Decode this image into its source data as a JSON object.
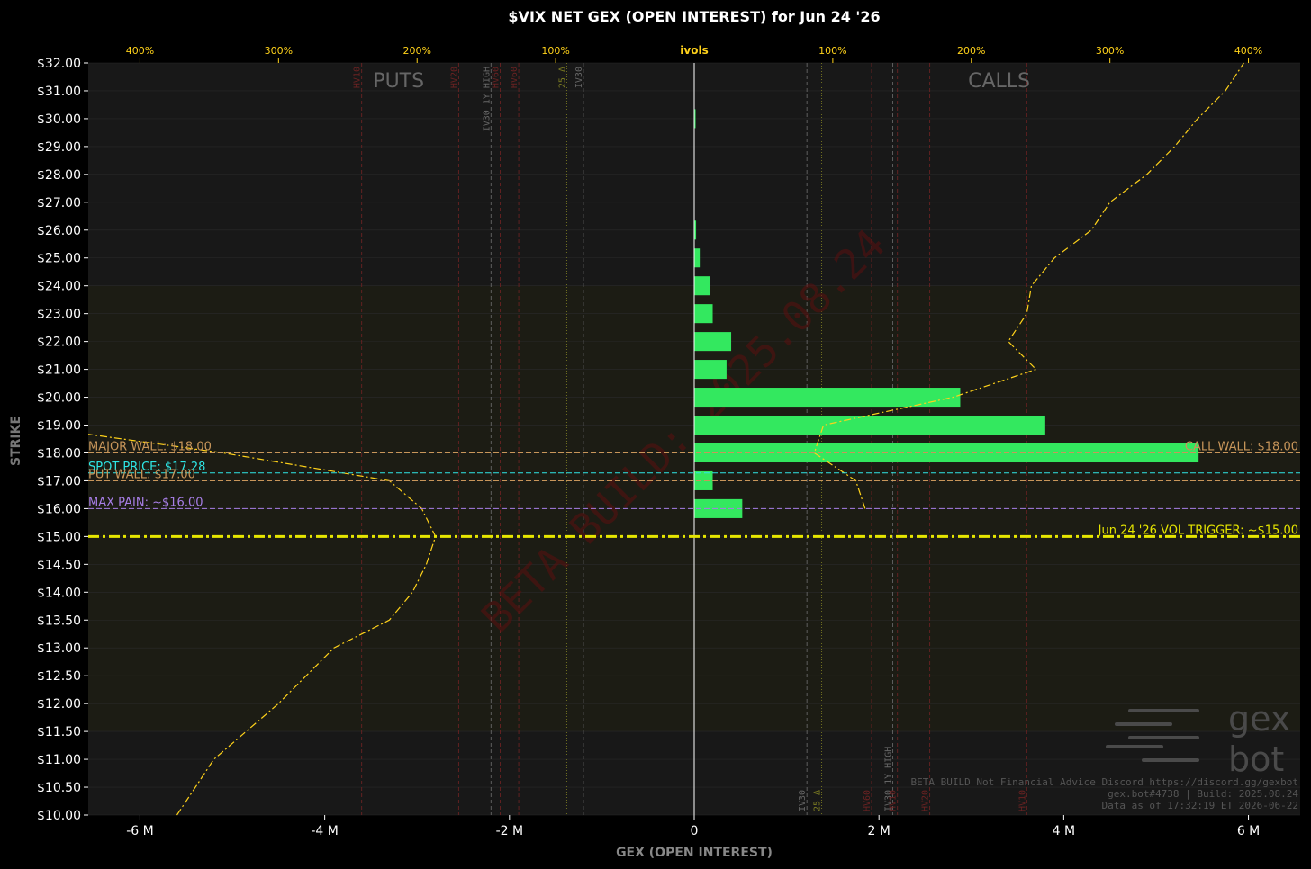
{
  "chart_data": {
    "type": "bar",
    "orientation": "horizontal",
    "title": "$VIX NET GEX (OPEN INTEREST) for Jun 24 '26",
    "xlabel": "GEX (OPEN INTEREST)",
    "ylabel": "STRIKE",
    "top_axis_label": "ivols",
    "xlim": [
      -6.56,
      6.56
    ],
    "x_ticks": [
      {
        "v": -6,
        "label": "-6 M"
      },
      {
        "v": -4,
        "label": "-4 M"
      },
      {
        "v": -2,
        "label": "-2 M"
      },
      {
        "v": 0,
        "label": "0"
      },
      {
        "v": 2,
        "label": "2 M"
      },
      {
        "v": 4,
        "label": "4 M"
      },
      {
        "v": 6,
        "label": "6 M"
      }
    ],
    "top_ticks": [
      {
        "v": -6.0,
        "label": "400%"
      },
      {
        "v": -4.5,
        "label": "300%"
      },
      {
        "v": -3.0,
        "label": "200%"
      },
      {
        "v": -1.5,
        "label": "100%"
      },
      {
        "v": 1.5,
        "label": "100%"
      },
      {
        "v": 3.0,
        "label": "200%"
      },
      {
        "v": 4.5,
        "label": "300%"
      },
      {
        "v": 6.0,
        "label": "400%"
      }
    ],
    "strike_labels": [
      "$10.00",
      "$10.50",
      "$11.00",
      "$11.50",
      "$12.00",
      "$12.50",
      "$13.00",
      "$13.50",
      "$14.00",
      "$14.50",
      "$15.00",
      "$16.00",
      "$17.00",
      "$18.00",
      "$19.00",
      "$20.00",
      "$21.00",
      "$22.00",
      "$23.00",
      "$24.00",
      "$25.00",
      "$26.00",
      "$27.00",
      "$28.00",
      "$29.00",
      "$30.00",
      "$31.00",
      "$32.00"
    ],
    "series": [
      {
        "color": "#33e85f",
        "categories": [
          "$30.00",
          "$26.00",
          "$25.00",
          "$24.00",
          "$23.00",
          "$22.00",
          "$21.00",
          "$20.00",
          "$19.00",
          "$18.00",
          "$17.00",
          "$16.00"
        ],
        "values": [
          0.01,
          0.02,
          0.06,
          0.17,
          0.2,
          0.4,
          0.35,
          2.88,
          3.8,
          5.46,
          0.2,
          0.52
        ]
      }
    ],
    "call_ivol_curve": {
      "color": "#ffd21a",
      "points": [
        [
          "$16.00",
          1.85
        ],
        [
          "$17.00",
          1.75
        ],
        [
          "$18.00",
          1.3
        ],
        [
          "$19.00",
          1.4
        ],
        [
          "$20.00",
          2.8
        ],
        [
          "$21.00",
          3.7
        ],
        [
          "$22.00",
          3.4
        ],
        [
          "$23.00",
          3.6
        ],
        [
          "$24.00",
          3.65
        ],
        [
          "$25.00",
          3.9
        ],
        [
          "$26.00",
          4.3
        ],
        [
          "$27.00",
          4.5
        ],
        [
          "$28.00",
          4.9
        ],
        [
          "$29.00",
          5.2
        ],
        [
          "$30.00",
          5.45
        ],
        [
          "$31.00",
          5.75
        ],
        [
          "$32.00",
          5.95
        ]
      ]
    },
    "put_ivol_curve": {
      "color": "#ffd21a",
      "points": [
        [
          "$10.00",
          -5.6
        ],
        [
          "$11.00",
          -5.2
        ],
        [
          "$12.00",
          -4.5
        ],
        [
          "$13.00",
          -3.9
        ],
        [
          "$13.50",
          -3.3
        ],
        [
          "$14.00",
          -3.05
        ],
        [
          "$14.50",
          -2.9
        ],
        [
          "$15.00",
          -2.8
        ],
        [
          "$16.00",
          -2.95
        ],
        [
          "$17.00",
          -3.3
        ],
        [
          "$18.00",
          -5.1
        ],
        [
          "$18.67",
          -6.56
        ]
      ]
    },
    "levels": [
      {
        "strike": "$18.00",
        "label": "MAJOR WALL: $18.00",
        "color": "#c8965a"
      },
      {
        "strike": "$17.28",
        "label": "SPOT PRICE: $17.28",
        "color": "#2ee6e6"
      },
      {
        "strike": "$17.00",
        "label": "PUT WALL: $17.00",
        "color": "#c8965a"
      },
      {
        "strike": "$16.00",
        "label": "MAX PAIN: ~$16.00",
        "color": "#a77ee6"
      },
      {
        "strike": "$15.00",
        "label": "Jun 24 '26 VOL TRIGGER: ~$15.00",
        "color": "#e6e600"
      },
      {
        "strike": "$18.00",
        "label": "CALL WALL: $18.00",
        "color": "#c8965a"
      }
    ],
    "vlines_put": [
      {
        "x": -3.6,
        "label": "HV10"
      },
      {
        "x": -2.55,
        "label": "HV20"
      },
      {
        "x": -2.2,
        "label": "IV30 1Y HIGH"
      },
      {
        "x": -2.1,
        "label": "HV60"
      },
      {
        "x": -1.9,
        "label": "HV60"
      },
      {
        "x": -1.2,
        "label": "IV30"
      },
      {
        "x": -1.38,
        "label": "25 Δ"
      }
    ],
    "vlines_call": [
      {
        "x": 1.22,
        "label": "IV30"
      },
      {
        "x": 1.38,
        "label": "25 Δ"
      },
      {
        "x": 1.92,
        "label": "HV60"
      },
      {
        "x": 2.15,
        "label": "IV30 1Y HIGH"
      },
      {
        "x": 2.2,
        "label": "HV10"
      },
      {
        "x": 2.55,
        "label": "HV20"
      },
      {
        "x": 3.6,
        "label": "HV10"
      }
    ],
    "side_labels": {
      "puts": "PUTS",
      "calls": "CALLS"
    },
    "watermark": "BETA BUILD: 2025.08.24",
    "footer": [
      "BETA BUILD Not Financial Advice Discord https://discord.gg/gexbot",
      "gex.bot#4738 | Build: 2025.08.24",
      "Data as of 17:32:19 ET 2026-06-22"
    ],
    "logo": {
      "line1": "gex",
      "line2": "bot"
    }
  }
}
